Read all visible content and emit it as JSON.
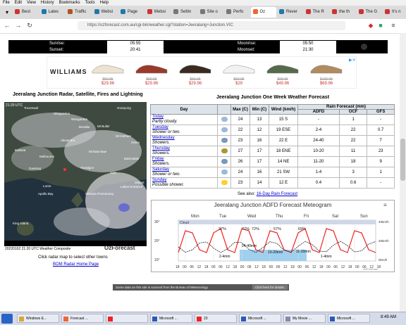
{
  "menu": [
    "File",
    "Edit",
    "View",
    "History",
    "Bookmarks",
    "Tools",
    "Help"
  ],
  "tabs": [
    {
      "label": "Best",
      "color": "#c33"
    },
    {
      "label": "Lates",
      "color": "#27a"
    },
    {
      "label": "Traffic",
      "color": "#a52"
    },
    {
      "label": "Websi",
      "color": "#27a"
    },
    {
      "label": "Page",
      "color": "#27a"
    },
    {
      "label": "Websi",
      "color": "#c33"
    },
    {
      "label": "Settin",
      "color": "#777"
    },
    {
      "label": "Site o",
      "color": "#777"
    },
    {
      "label": "Perfo",
      "color": "#777"
    },
    {
      "label": "Oz",
      "color": "#e63"
    },
    {
      "label": "Rever",
      "color": "#27a"
    },
    {
      "label": "The R",
      "color": "#c33"
    },
    {
      "label": "the th",
      "color": "#c33"
    },
    {
      "label": "The G",
      "color": "#c33"
    },
    {
      "label": "It's n",
      "color": "#c33"
    }
  ],
  "url": "https://ozforecast.com.au/cgi-bin/weather.cgi?station=Jeeralang+Junction.VIC",
  "sun": {
    "sunrise_label": "Sunrise:",
    "sunrise": "05:55",
    "sunset_label": "Sunset:",
    "sunset": "20:41",
    "moonrise_label": "Moonrise:",
    "moonrise": "05:50",
    "moonset_label": "Moonset:",
    "moonset": "21:30"
  },
  "ad": {
    "brand": "WILLIAMS",
    "products": [
      {
        "old": "$59.95",
        "price": "$29.96",
        "color": "#eee2d0"
      },
      {
        "old": "$59.95",
        "price": "$29.96",
        "color": "#9a3a2a"
      },
      {
        "old": "$59.95",
        "price": "$29.96",
        "color": "#3a2a22"
      },
      {
        "old": "$59.95",
        "price": "$29",
        "color": "#f2f2f2"
      },
      {
        "old": "$99.95",
        "price": "$49.96",
        "color": "#556a4a"
      },
      {
        "old": "$139.95",
        "price": "$69.96",
        "color": "#b08a60"
      }
    ]
  },
  "radar": {
    "heading": "Jeeralang Junction Radar, Satellite, Fires and Lightning",
    "timestamp": "21:20 UTC",
    "places": [
      "Shepparton",
      "Wangaratta",
      "Gooryong",
      "Benalla",
      "Tocumwal",
      "Mt Buller",
      "Mt Hotham",
      "Alexandra",
      "Mt Baw Baw",
      "Ballarat",
      "Melbourne",
      "Geelong",
      "Traralgon",
      "Sale",
      "Lakes Entrance",
      "Orbost",
      "Lorne",
      "Apollo Bay",
      "Wilsons Promontory",
      "King Island",
      "Bairnsdale",
      "Omeo"
    ],
    "caption": "20220102 21:20 UTC Weather Composite",
    "brand": "OzForecast",
    "instruction": "Click radar map to select other towns",
    "link": "BOM Radar Home Page"
  },
  "forecast": {
    "heading": "Jeeralang Junction One Week Weather Forecast",
    "headers": {
      "day": "Day",
      "max": "Max (C)",
      "min": "Min (C)",
      "wind": "Wind (km/h)",
      "rain": "Rain Forecast (mm)",
      "adfd": "ADFD",
      "ocf": "OCF",
      "gfs": "GFS"
    },
    "rows": [
      {
        "day": "Today",
        "desc": "Partly cloudy.",
        "max": "24",
        "min": "13",
        "wind": "15 S",
        "adfd": "-",
        "ocf": "1",
        "gfs": "-"
      },
      {
        "day": "Tuesday",
        "desc": "Shower or two.",
        "max": "22",
        "min": "12",
        "wind": "19 ESE",
        "adfd": "2-4",
        "ocf": "22",
        "gfs": "0.7"
      },
      {
        "day": "Wednesday",
        "desc": "Showers.",
        "max": "23",
        "min": "16",
        "wind": "22 E",
        "adfd": "24-40",
        "ocf": "22",
        "gfs": "7"
      },
      {
        "day": "Thursday",
        "desc": "Showers.",
        "max": "27",
        "min": "17",
        "wind": "18 ENE",
        "adfd": "10-20",
        "ocf": "11",
        "gfs": "23"
      },
      {
        "day": "Friday",
        "desc": "Showers.",
        "max": "26",
        "min": "17",
        "wind": "14 NE",
        "adfd": "11-20",
        "ocf": "18",
        "gfs": "9"
      },
      {
        "day": "Saturday",
        "desc": "Shower or two.",
        "max": "24",
        "min": "16",
        "wind": "21 SW",
        "adfd": "1-4",
        "ocf": "3",
        "gfs": "1"
      },
      {
        "day": "Sunday",
        "desc": "Possible shower.",
        "max": "23",
        "min": "14",
        "wind": "12 E",
        "adfd": "0.4",
        "ocf": "0.6",
        "gfs": "-"
      }
    ],
    "see_also": "See also:",
    "see_also_link": "16-Day Rain Forecast"
  },
  "meteogram": {
    "title": "Jeeralang Junction ADFD Forecast Meteogram",
    "days": [
      "Mon",
      "Tue",
      "Wed",
      "Thu",
      "Fri",
      "Sat",
      "Sun"
    ],
    "hours": [
      "18",
      "00",
      "06",
      "12",
      "18",
      "00",
      "06",
      "12",
      "18",
      "00",
      "06",
      "12",
      "18",
      "00",
      "06",
      "12",
      "18",
      "00",
      "06",
      "12",
      "18",
      "00",
      "06",
      "12",
      "18",
      "00",
      "06",
      "12",
      "18"
    ],
    "cloud_label": "Cloud",
    "cloud_pcts": [
      "37%",
      "77%",
      "72%",
      "57%",
      "69%"
    ],
    "rain_labels": [
      "2-4mm",
      "24-40mm",
      "10-20mm",
      "11-20mm",
      "1-4mm"
    ],
    "left_axis": [
      "30°",
      "20°",
      "10°"
    ],
    "right_axis": [
      "40km/h",
      "20km/h",
      "0km/h"
    ],
    "credit": "OzForecast"
  },
  "status": {
    "text": "Some data on this site is sourced from the Bureau of Meteorology.",
    "button": "Click here for details."
  },
  "taskbar": [
    {
      "label": "Windows E..."
    },
    {
      "label": "Forecast ..."
    },
    {
      "label": ""
    },
    {
      "label": "Microsoft ..."
    },
    {
      "label": "23"
    },
    {
      "label": "Microsoft ..."
    },
    {
      "label": "My Movie ..."
    },
    {
      "label": "Microsoft ..."
    }
  ],
  "clock": "8:49 AM"
}
